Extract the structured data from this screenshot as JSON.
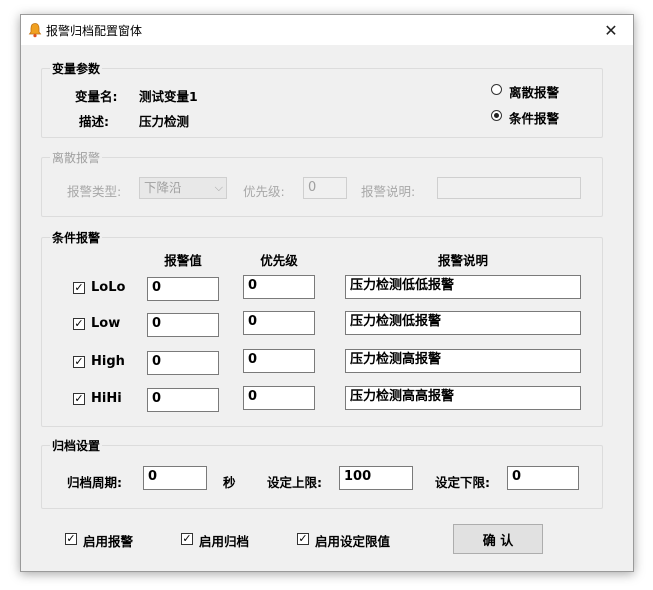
{
  "window": {
    "title": "报警归档配置窗体"
  },
  "variable_params": {
    "group_label": "变量参数",
    "name_label": "变量名:",
    "name_value": "测试变量1",
    "desc_label": "描述:",
    "desc_value": "压力检测",
    "mode_options": [
      {
        "label": "离散报警",
        "checked": false
      },
      {
        "label": "条件报警",
        "checked": true
      }
    ]
  },
  "discrete_alarm": {
    "group_label": "离散报警",
    "type_label": "报警类型:",
    "type_value": "下降沿",
    "priority_label": "优先级:",
    "priority_value": "0",
    "desc_label": "报警说明:",
    "desc_value": ""
  },
  "condition_alarm": {
    "group_label": "条件报警",
    "columns": [
      "报警值",
      "优先级",
      "报警说明"
    ],
    "rows": [
      {
        "name": "LoLo",
        "checked": true,
        "value": "0",
        "priority": "0",
        "desc": "压力检测低低报警"
      },
      {
        "name": "Low",
        "checked": true,
        "value": "0",
        "priority": "0",
        "desc": "压力检测低报警"
      },
      {
        "name": "High",
        "checked": true,
        "value": "0",
        "priority": "0",
        "desc": "压力检测高报警"
      },
      {
        "name": "HiHi",
        "checked": true,
        "value": "0",
        "priority": "0",
        "desc": "压力检测高高报警"
      }
    ]
  },
  "archive": {
    "group_label": "归档设置",
    "period_label": "归档周期:",
    "period_value": "0",
    "period_unit": "秒",
    "upper_label": "设定上限:",
    "upper_value": "100",
    "lower_label": "设定下限:",
    "lower_value": "0"
  },
  "footer": {
    "enable_alarm": {
      "label": "启用报警",
      "checked": true
    },
    "enable_archive": {
      "label": "启用归档",
      "checked": true
    },
    "enable_limit": {
      "label": "启用设定限值",
      "checked": true
    },
    "confirm_label": "确 认"
  }
}
